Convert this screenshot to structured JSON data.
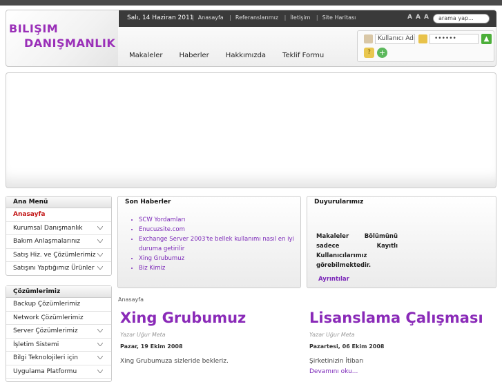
{
  "logo": {
    "line1": "BILIŞIM",
    "line2": "DANIŞMANLIK"
  },
  "topbar": {
    "date": "Salı, 14 Haziran 2011",
    "links": [
      "Anasayfa",
      "Referanslarımız",
      "İletişim",
      "Site Haritası"
    ],
    "font_sizes": [
      "A",
      "A",
      "A"
    ],
    "search_placeholder": "arama yap..."
  },
  "nav": [
    "Makaleler",
    "Haberler",
    "Hakkımızda",
    "Teklif Formu"
  ],
  "login": {
    "username_value": "Kullanıcı Adı",
    "password_value": "••••••"
  },
  "main_menu": {
    "title": "Ana Menü",
    "items": [
      {
        "label": "Anasayfa",
        "active": true,
        "has_sub": false
      },
      {
        "label": "Kurumsal Danışmanlık",
        "has_sub": true
      },
      {
        "label": "Bakım Anlaşmalarınız",
        "has_sub": true
      },
      {
        "label": "Satış Hiz. ve Çözümlerimiz",
        "has_sub": true
      },
      {
        "label": "Satışını Yaptığımız Ürünler",
        "has_sub": true
      }
    ]
  },
  "solutions_menu": {
    "title": "Çözümlerimiz",
    "items": [
      {
        "label": "Backup Çözümlerimiz",
        "has_sub": false
      },
      {
        "label": "Network Çözümlerimiz",
        "has_sub": false
      },
      {
        "label": "Server Çözümlerimiz",
        "has_sub": true
      },
      {
        "label": "İşletim Sistemi",
        "has_sub": true
      },
      {
        "label": "Bilgi Teknolojileri için",
        "has_sub": true
      },
      {
        "label": "Uygulama Platformu",
        "has_sub": true
      }
    ]
  },
  "news": {
    "title": "Son Haberler",
    "items": [
      "SCW Yordamları",
      "Enucuzsite.com",
      "Exchange Server 2003'te bellek kullanımı nasıl en iyi duruma getirilir",
      "Xing Grubumuz",
      "Biz Kimiz"
    ]
  },
  "announcements": {
    "title": "Duyurularımız",
    "text": "Makaleler Bölümünü sadece Kayıtlı Kullanıcılarımız görebilmektedir.",
    "more": "Ayrıntılar"
  },
  "breadcrumb": "Anasayfa",
  "posts": [
    {
      "title": "Xing Grubumuz",
      "author": "Yazar Uğur Meta",
      "date": "Pazar, 19 Ekim 2008",
      "body": "Xing Grubumuza sizleride bekleriz.",
      "more": ""
    },
    {
      "title": "Lisanslama Çalışması",
      "author": "Yazar Uğur Meta",
      "date": "Pazartesi, 06 Ekim 2008",
      "body": "Şirketinizin İtibarı",
      "more": "Devamını oku..."
    }
  ]
}
